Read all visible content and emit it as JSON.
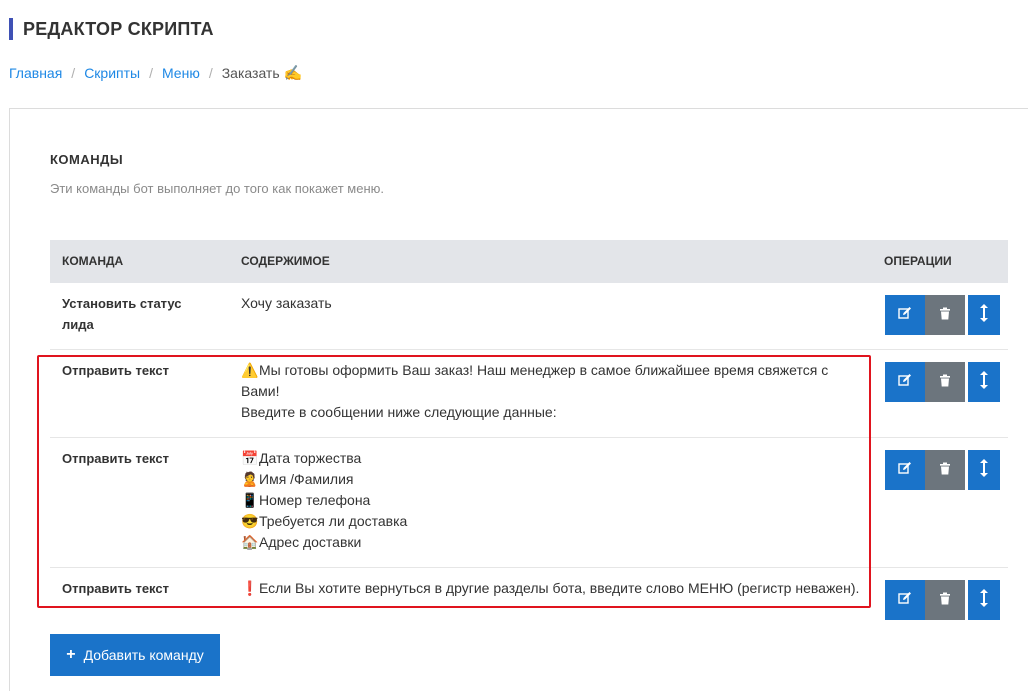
{
  "header": {
    "title": "РЕДАКТОР СКРИПТА"
  },
  "breadcrumb": {
    "items": [
      {
        "label": "Главная"
      },
      {
        "label": "Скрипты"
      },
      {
        "label": "Меню"
      }
    ],
    "separator": "/",
    "current": "Заказать",
    "current_icon": "✍"
  },
  "section": {
    "title": "КОМАНДЫ",
    "description": "Эти команды бот выполняет до того как покажет меню."
  },
  "table": {
    "columns": {
      "command": "КОМАНДА",
      "content": "СОДЕРЖИМОЕ",
      "operations": "ОПЕРАЦИИ"
    },
    "rows": [
      {
        "command": "Установить статус лида",
        "lines": [
          {
            "icon": "",
            "text": "Хочу заказать"
          }
        ]
      },
      {
        "command": "Отправить текст",
        "lines": [
          {
            "icon": "⚠️",
            "text": "Мы готовы оформить Ваш заказ! Наш менеджер в самое ближайшее время свяжется с Вами!"
          },
          {
            "icon": "",
            "text": "Введите в сообщении ниже следующие данные:"
          }
        ]
      },
      {
        "command": "Отправить текст",
        "lines": [
          {
            "icon": "📅",
            "text": "Дата торжества"
          },
          {
            "icon": "🙎",
            "text": "Имя /Фамилия"
          },
          {
            "icon": "📱",
            "text": "Номер телефона"
          },
          {
            "icon": "😎",
            "text": "Требуется ли доставка"
          },
          {
            "icon": "🏠",
            "text": "Адрес доставки"
          }
        ]
      },
      {
        "command": "Отправить текст",
        "lines": [
          {
            "icon": "❗",
            "text": "Если Вы хотите вернуться в другие разделы бота, введите слово МЕНЮ (регистр неважен)."
          }
        ]
      }
    ],
    "operation_icons": {
      "edit": "edit-icon",
      "delete": "trash-icon",
      "move": "drag-icon"
    }
  },
  "add_button": {
    "label": "Добавить команду",
    "icon": "+"
  },
  "colors": {
    "primary": "#1a73c9",
    "secondary": "#6c757d",
    "highlight": "#e0141e",
    "header_bar": "#3f51b5"
  }
}
